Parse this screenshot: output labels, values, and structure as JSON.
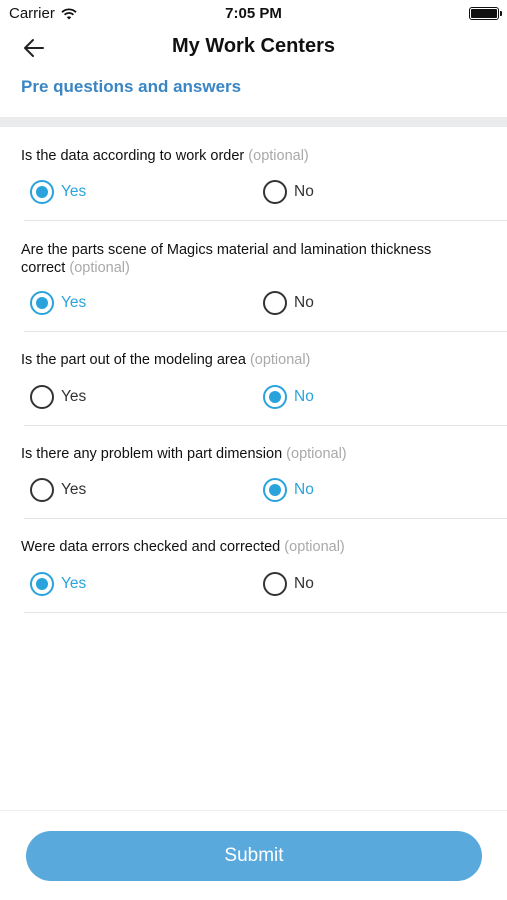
{
  "status_bar": {
    "carrier": "Carrier",
    "time": "7:05 PM"
  },
  "nav": {
    "title": "My Work Centers",
    "back_icon": "arrow-left-icon"
  },
  "section_title": "Pre questions and answers",
  "colors": {
    "accent": "#2aa3dc",
    "link": "#3a86c4",
    "button": "#5aa9dc"
  },
  "questions": [
    {
      "text": "Is the data according to work order",
      "optional": "(optional)",
      "yes": "Yes",
      "no": "No",
      "selected": "Yes"
    },
    {
      "text": "Are the parts scene of Magics material and lamination thickness correct",
      "optional": "(optional)",
      "yes": "Yes",
      "no": "No",
      "selected": "Yes"
    },
    {
      "text": "Is the part out of the modeling area",
      "optional": "(optional)",
      "yes": "Yes",
      "no": "No",
      "selected": "No"
    },
    {
      "text": "Is there any problem with part dimension",
      "optional": "(optional)",
      "yes": "Yes",
      "no": "No",
      "selected": "No"
    },
    {
      "text": "Were data errors checked and corrected",
      "optional": "(optional)",
      "yes": "Yes",
      "no": "No",
      "selected": "Yes"
    }
  ],
  "submit_label": "Submit"
}
